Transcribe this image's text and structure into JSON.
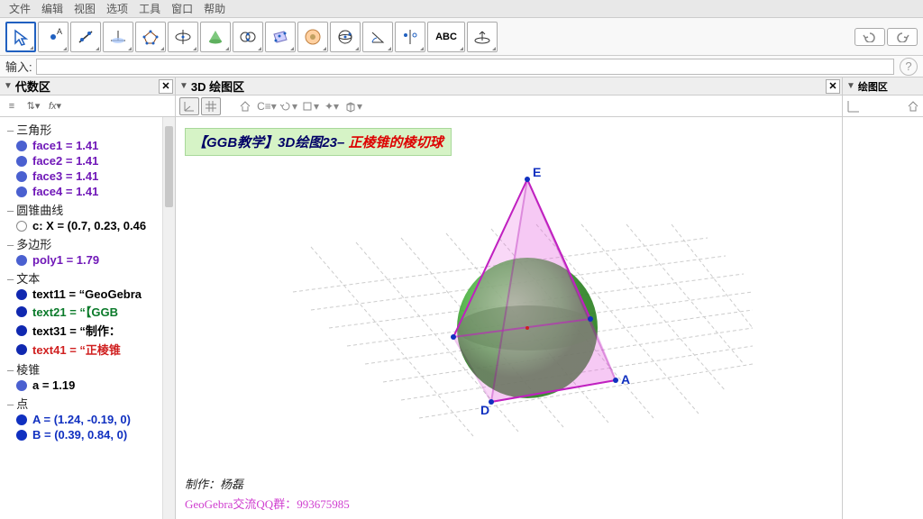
{
  "menu": [
    "文件",
    "编辑",
    "视图",
    "选项",
    "工具",
    "窗口",
    "帮助"
  ],
  "input_label": "输入:",
  "panels": {
    "algebra": "代数区",
    "view3d": "3D 绘图区",
    "graphics": "绘图区"
  },
  "toolbar_text_btn": "ABC",
  "fx_label": "fx",
  "algebra_tree": {
    "groups": [
      {
        "label": "三角形",
        "items": [
          {
            "text": "face1 = 1.41",
            "color": "#7018b8",
            "bold": true
          },
          {
            "text": "face2 = 1.41",
            "color": "#7018b8",
            "bold": true
          },
          {
            "text": "face3 = 1.41",
            "color": "#7018b8",
            "bold": true
          },
          {
            "text": "face4 = 1.41",
            "color": "#7018b8",
            "bold": true
          }
        ]
      },
      {
        "label": "圆锥曲线",
        "items": [
          {
            "text": "c: X = (0.7, 0.23, 0.46",
            "color": "#000",
            "bold": true,
            "hollow": true
          }
        ]
      },
      {
        "label": "多边形",
        "items": [
          {
            "text": "poly1 = 1.79",
            "color": "#7018b8",
            "bold": true
          }
        ]
      },
      {
        "label": "文本",
        "items": [
          {
            "text": "text11 = “GeoGebra",
            "color": "#000",
            "bold": true,
            "dot": "#1028b0"
          },
          {
            "text": "text21  = “【GGB",
            "color": "#0a7a2a",
            "bold": true,
            "dot": "#1028b0"
          },
          {
            "text": "text31  = “制作：",
            "color": "#000",
            "bold": true,
            "dot": "#1028b0"
          },
          {
            "text": "text41  = “正棱锥",
            "color": "#d02020",
            "bold": true,
            "dot": "#1028b0"
          }
        ]
      },
      {
        "label": "棱锥",
        "items": [
          {
            "text": "a = 1.19",
            "color": "#000",
            "bold": true,
            "dot": "#4a60d0"
          }
        ]
      },
      {
        "label": "点",
        "items": [
          {
            "text": "A = (1.24, -0.19, 0)",
            "color": "#1030c0",
            "bold": true,
            "dot": "#1030c0"
          },
          {
            "text": "B = (0.39, 0.84, 0)",
            "color": "#1030c0",
            "bold": true,
            "dot": "#1030c0"
          }
        ]
      }
    ]
  },
  "title": {
    "pre": "【GGB教学】3D绘图23– ",
    "red": "正棱锥的棱切球"
  },
  "author": "制作：杨磊",
  "qq": "GeoGebra交流QQ群：993675985",
  "points": {
    "A": "A",
    "D": "D",
    "E": "E"
  }
}
